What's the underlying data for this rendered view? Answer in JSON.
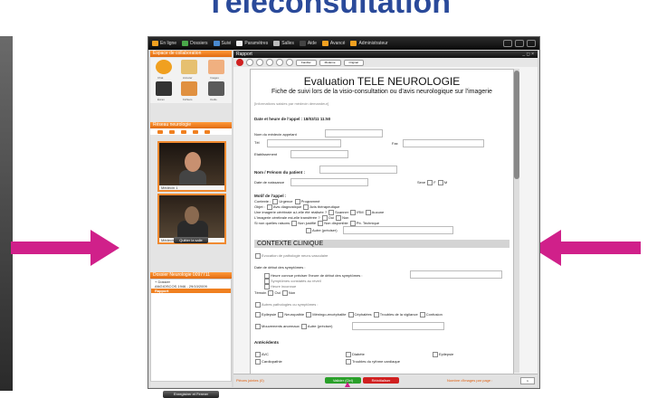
{
  "slide": {
    "title": "Téléconsultation",
    "accent_color": "#d0208a",
    "title_color": "#2a4a9a"
  },
  "topbar": {
    "items": [
      {
        "icon": "status-icon",
        "label": "En ligne"
      },
      {
        "icon": "video-icon",
        "label": "Dossiers"
      },
      {
        "icon": "book-icon",
        "label": "Suivi"
      },
      {
        "icon": "gear-icon",
        "label": "Paramètres"
      },
      {
        "icon": "room-icon",
        "label": "Salles"
      },
      {
        "icon": "help-icon",
        "label": "Aide"
      },
      {
        "icon": "warning-icon",
        "label": "Avancé"
      },
      {
        "icon": "admin-icon",
        "label": "Administrateur"
      }
    ]
  },
  "left": {
    "tools_title": "Espace de collaboration",
    "tools": [
      {
        "icon": "chat-icon",
        "label": "Chat"
      },
      {
        "icon": "pen-icon",
        "label": "Annoter"
      },
      {
        "icon": "image-icon",
        "label": "Images"
      },
      {
        "icon": "screen-icon",
        "label": "Écran"
      },
      {
        "icon": "files-icon",
        "label": "Fichiers"
      },
      {
        "icon": "tools-icon",
        "label": "Outils"
      }
    ],
    "video_title": "Réseau neurologie",
    "videos": [
      {
        "label": "Médecin 1"
      },
      {
        "label": "Médecin 2"
      }
    ],
    "quit_label": "Quitter la salle",
    "dossier_title": "Dossier Neurologie 0097711",
    "dossier_items": [
      {
        "label": "+ Dossier",
        "selected": false
      },
      {
        "label": "  ANGIOSCOS 1946 - 29/10/2009",
        "selected": false
      },
      {
        "label": "  Rapport",
        "selected": true
      }
    ],
    "save_label": "Enregistrer et Fermer"
  },
  "report": {
    "panel_title": "Rapport",
    "format_buttons": [
      "Familier",
      "Moderne",
      "Original"
    ],
    "title": "Evaluation TELE NEUROLOGIE",
    "subtitle": "Fiche de suivi lors de la visio-consultation ou d'avis neurologique sur l'imagerie",
    "note": "[Informations saisies par médecin demandeur]",
    "date_label": "Date et heure de l'appel : 18/03/11 11:50",
    "caller_name": "Nom du médecin appelant",
    "tel": "Tél",
    "fax": "Fax",
    "establishment": "Etablissement",
    "patient_name": "Nom / Prénom du patient :",
    "dob": "Date de naissance",
    "sex": "Sexe",
    "sex_options": [
      "F",
      "M"
    ],
    "motif_title": "Motif de l'appel :",
    "contexte": "Contexte :",
    "contexte_options": [
      "Urgence",
      "Programmé"
    ],
    "objet": "Objet :",
    "objet_options": [
      "Avis diagnostique",
      "Avis thérapeutique"
    ],
    "imagerie": "Une imagerie cérébrale a-t-elle été réalisée ?",
    "imagerie_options": [
      "Scanner",
      "IRM",
      "Aucune"
    ],
    "imagerie_transferee": "L'imagerie cérébrale est-elle transférée ?",
    "imagerie_transferee_options": [
      "Oui",
      "Non"
    ],
    "raisons": "Si non quelles raisons",
    "raisons_options": [
      "Non justifié",
      "Non disponible",
      "Pb. Technique"
    ],
    "autre": "Autre (préciser)",
    "section_contexte": "CONTEXTE CLINIQUE",
    "evocation": "Evocation de pathologie neuro-vasculaire",
    "debut": "Date de début des symptômes :",
    "heure": "Heure connue",
    "heure_precise": "préciser l'heure de début des symptômes :",
    "symptomes_eveil": "Symptômes constatés au réveil",
    "heure_inconnue": "Heure inconnue",
    "temoin": "Témoin",
    "temoin_options": [
      "Oui",
      "Non"
    ],
    "autres_symptomes": "Autres pathologies ou symptômes :",
    "symptom_options": [
      "Epilepsie",
      "Neuropathie",
      "Méningo-encéphalite",
      "Céphalées",
      "Troubles de la vigilance",
      "Confusion"
    ],
    "mouvements": "Mouvements anormaux",
    "autre2": "Autre (préciser)",
    "antecedents": "Antécédents",
    "antecedent_options": [
      "AVC",
      "Diabète",
      "Epilepsie",
      "Cardiopathie",
      "Troubles du rythme cardiaque"
    ]
  },
  "bottom": {
    "left_label": "Pièces jointes (0)",
    "validate_label": "Valider (Ctrl)",
    "cancel_label": "Réinitialiser",
    "images_label": "Nombre d'images par page :",
    "images_value": "1"
  }
}
